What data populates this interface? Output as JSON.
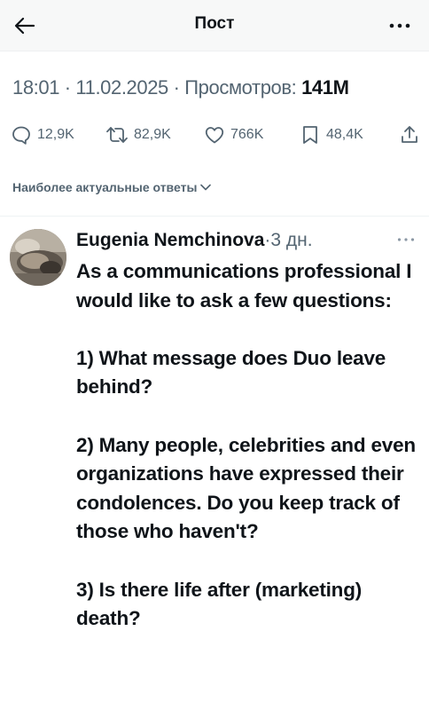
{
  "header": {
    "title": "Пост",
    "back_icon": "arrow-left-icon",
    "more_icon": "more-horizontal-icon"
  },
  "post_meta": {
    "time": "18:01",
    "separator": " · ",
    "date": "11.02.2025",
    "views_label": "Просмотров:",
    "views_count": "141M"
  },
  "actions": {
    "replies": "12,9K",
    "reposts": "82,9K",
    "likes": "766K",
    "bookmarks": "48,4K",
    "icons": [
      "reply-icon",
      "repost-icon",
      "like-icon",
      "bookmark-icon",
      "share-icon"
    ]
  },
  "sort": {
    "label": "Наиболее актуальные ответы"
  },
  "reply": {
    "author": "Eugenia Nemchinova",
    "separator": "·",
    "time": "3 дн.",
    "text": "As a communications professional I would like to ask a few questions:\n\n1) What message does Duo leave behind?\n\n2) Many people, celebrities and even organizations have expressed their condolences. Do you keep track of those who haven't?\n\n3) Is there life after (marketing) death?"
  },
  "colors": {
    "text_primary": "#0f1419",
    "text_secondary": "#536471",
    "header_bg": "#f7f8f8",
    "divider": "#eff3f4"
  }
}
